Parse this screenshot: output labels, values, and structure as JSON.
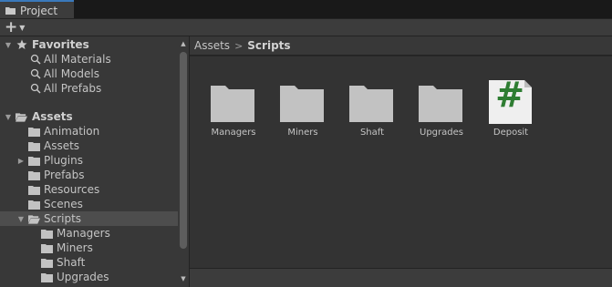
{
  "window": {
    "tab_label": "Project"
  },
  "toolbar": {
    "create_label": "+"
  },
  "tree": {
    "favorites_label": "Favorites",
    "favorites": [
      {
        "label": "All Materials"
      },
      {
        "label": "All Models"
      },
      {
        "label": "All Prefabs"
      }
    ],
    "assets_label": "Assets",
    "assets_children": [
      {
        "label": "Animation"
      },
      {
        "label": "Assets"
      },
      {
        "label": "Plugins"
      },
      {
        "label": "Prefabs"
      },
      {
        "label": "Resources"
      },
      {
        "label": "Scenes"
      },
      {
        "label": "Scripts"
      }
    ],
    "scripts_children": [
      {
        "label": "Managers"
      },
      {
        "label": "Miners"
      },
      {
        "label": "Shaft"
      },
      {
        "label": "Upgrades"
      }
    ]
  },
  "breadcrumb": {
    "root": "Assets",
    "separator": ">",
    "current": "Scripts"
  },
  "grid_items": [
    {
      "name": "Managers",
      "icon": "folder-icon"
    },
    {
      "name": "Miners",
      "icon": "folder-icon"
    },
    {
      "name": "Shaft",
      "icon": "folder-icon"
    },
    {
      "name": "Upgrades",
      "icon": "folder-icon"
    },
    {
      "name": "Deposit",
      "icon": "csharp-script-icon",
      "glyph": "#"
    }
  ],
  "colors": {
    "tab_accent": "#3a79bb",
    "folder": "#c2c2c2",
    "script_hash": "#2e7d32",
    "selection": "#4d4d4d"
  }
}
